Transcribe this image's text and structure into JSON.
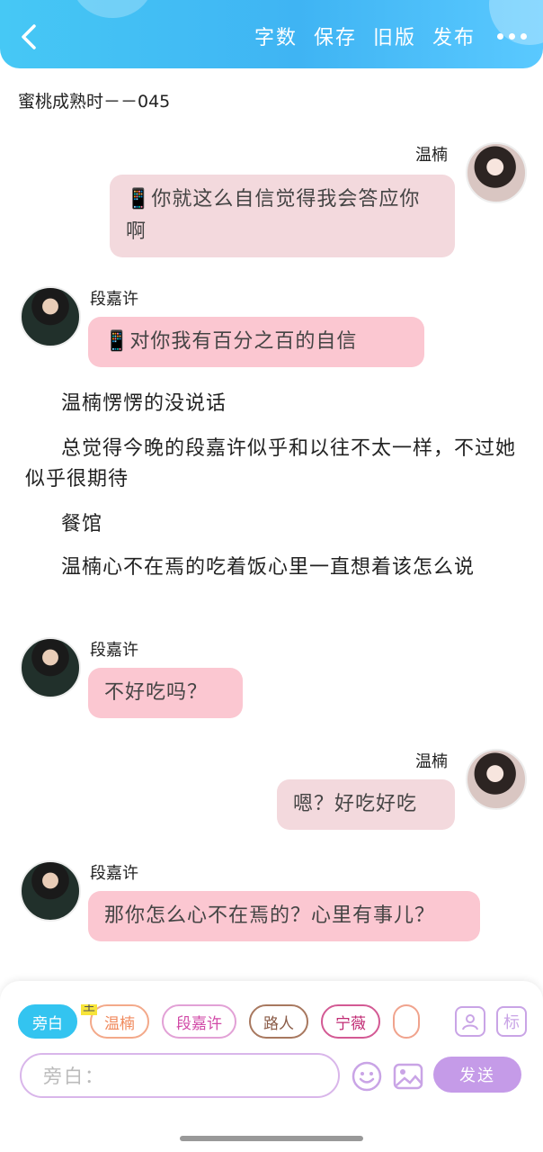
{
  "header": {
    "actions": [
      "字数",
      "保存",
      "旧版",
      "发布"
    ],
    "back_icon": "chevron-left-icon",
    "more_icon": "more-dots-icon",
    "gradient": [
      "#46c8f5",
      "#5ac9ff"
    ]
  },
  "doc_title": "蜜桃成熟时－－045",
  "messages": {
    "m1": {
      "speaker": "温楠",
      "text": "📱你就这么自信觉得我会答应你啊"
    },
    "m2": {
      "speaker": "段嘉许",
      "text": "📱对你我有百分之百的自信"
    },
    "n1": "温楠愣愣的没说话",
    "n2": "总觉得今晚的段嘉许似乎和以往不太一样，不过她似乎很期待",
    "n3": "餐馆",
    "n4": "温楠心不在焉的吃着饭心里一直想着该怎么说",
    "m3": {
      "speaker": "段嘉许",
      "text": "不好吃吗？"
    },
    "m4": {
      "speaker": "温楠",
      "text": "嗯？好吃好吃"
    },
    "m5": {
      "speaker": "段嘉许",
      "text": "那你怎么心不在焉的？心里有事儿？"
    }
  },
  "composer": {
    "chips": [
      "旁白",
      "温楠",
      "段嘉许",
      "路人",
      "宁薇"
    ],
    "main_tag": "主",
    "input_placeholder": "旁白：",
    "send_label": "发送",
    "tag_button": "标",
    "colors": {
      "active_chip": "#33c4f0",
      "send": "#c59be8"
    }
  }
}
